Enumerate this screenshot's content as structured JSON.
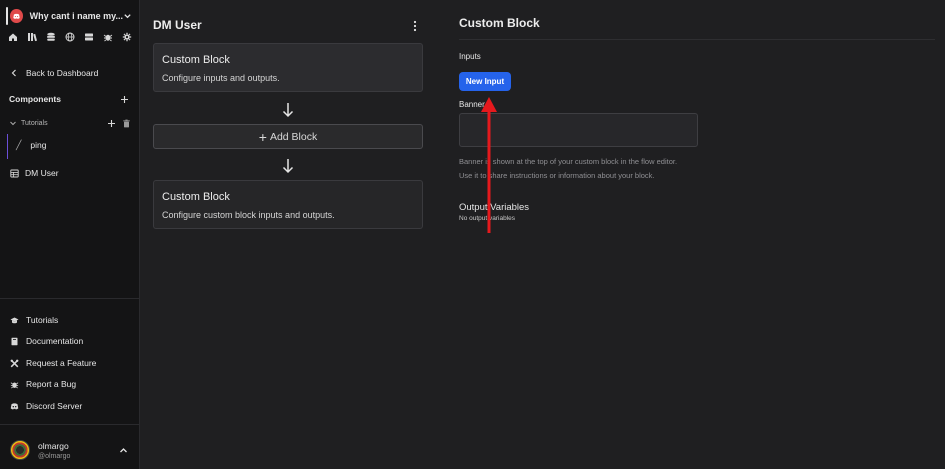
{
  "sidebar": {
    "server_name": "Why cant i name my...",
    "back_label": "Back to Dashboard",
    "components_label": "Components",
    "folder_label": "Tutorials",
    "items": [
      {
        "label": "ping",
        "icon": "slash-icon"
      },
      {
        "label": "DM User",
        "icon": "table-icon"
      }
    ],
    "bottom_links": [
      {
        "label": "Tutorials",
        "icon": "graduation-cap-icon"
      },
      {
        "label": "Documentation",
        "icon": "book-icon"
      },
      {
        "label": "Request a Feature",
        "icon": "tools-icon"
      },
      {
        "label": "Report a Bug",
        "icon": "bug-icon"
      },
      {
        "label": "Discord Server",
        "icon": "discord-icon"
      }
    ],
    "user": {
      "name": "olmargo",
      "handle": "@olmargo"
    }
  },
  "flow": {
    "title": "DM User",
    "cards": [
      {
        "title": "Custom Block",
        "desc": "Configure inputs and outputs."
      },
      {
        "title": "Custom Block",
        "desc": "Configure custom block inputs and outputs."
      }
    ],
    "add_block_label": "Add Block"
  },
  "panel": {
    "title": "Custom Block",
    "inputs_label": "Inputs",
    "new_input_label": "New Input",
    "banner_label": "Banner",
    "banner_help": "Banner is shown at the top of your custom block in the flow editor. Use it to share instructions or information about your block.",
    "output_label": "Output Variables",
    "output_empty": "No output variables"
  },
  "colors": {
    "accent_blue": "#2563eb",
    "annotation_red": "#e5191d",
    "tree_accent": "#6b4fd8"
  }
}
